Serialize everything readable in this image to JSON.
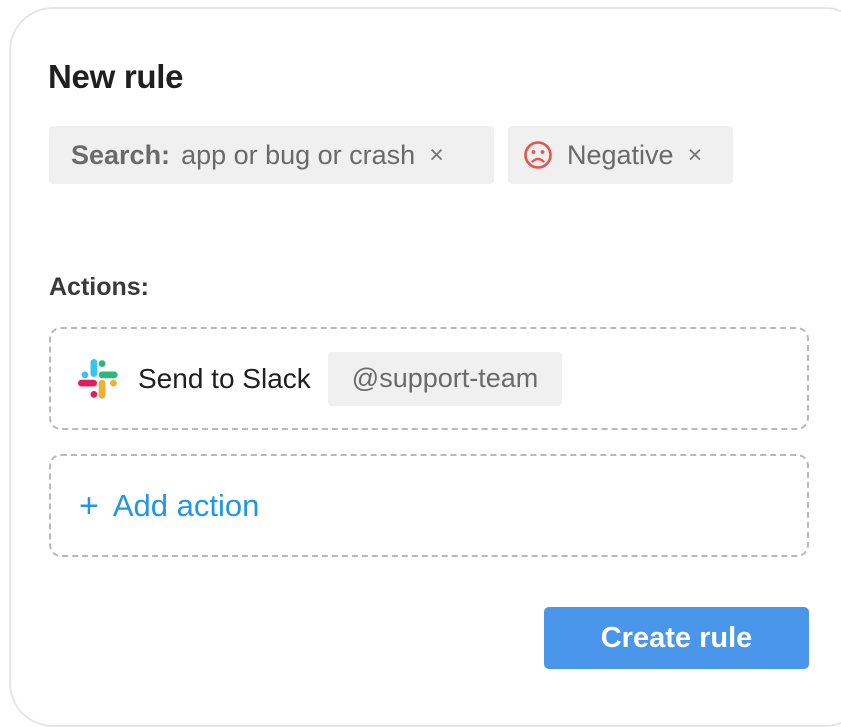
{
  "rule": {
    "title": "New rule"
  },
  "filters": {
    "search_key": "Search:",
    "search_value": "app or bug or crash",
    "sentiment_label": "Negative",
    "sentiment_icon": "frown-face-icon",
    "remove_glyph": "×"
  },
  "actions": {
    "label": "Actions:",
    "items": [
      {
        "icon": "slack-icon",
        "name": "Send to Slack",
        "target": "@support-team"
      }
    ],
    "add_icon": "+",
    "add_label": "Add action"
  },
  "footer": {
    "create_label": "Create rule"
  },
  "colors": {
    "accent": "#2196e8",
    "button": "#4a96ea",
    "negative": "#e8534f",
    "chip_bg": "#f0f0f0"
  }
}
